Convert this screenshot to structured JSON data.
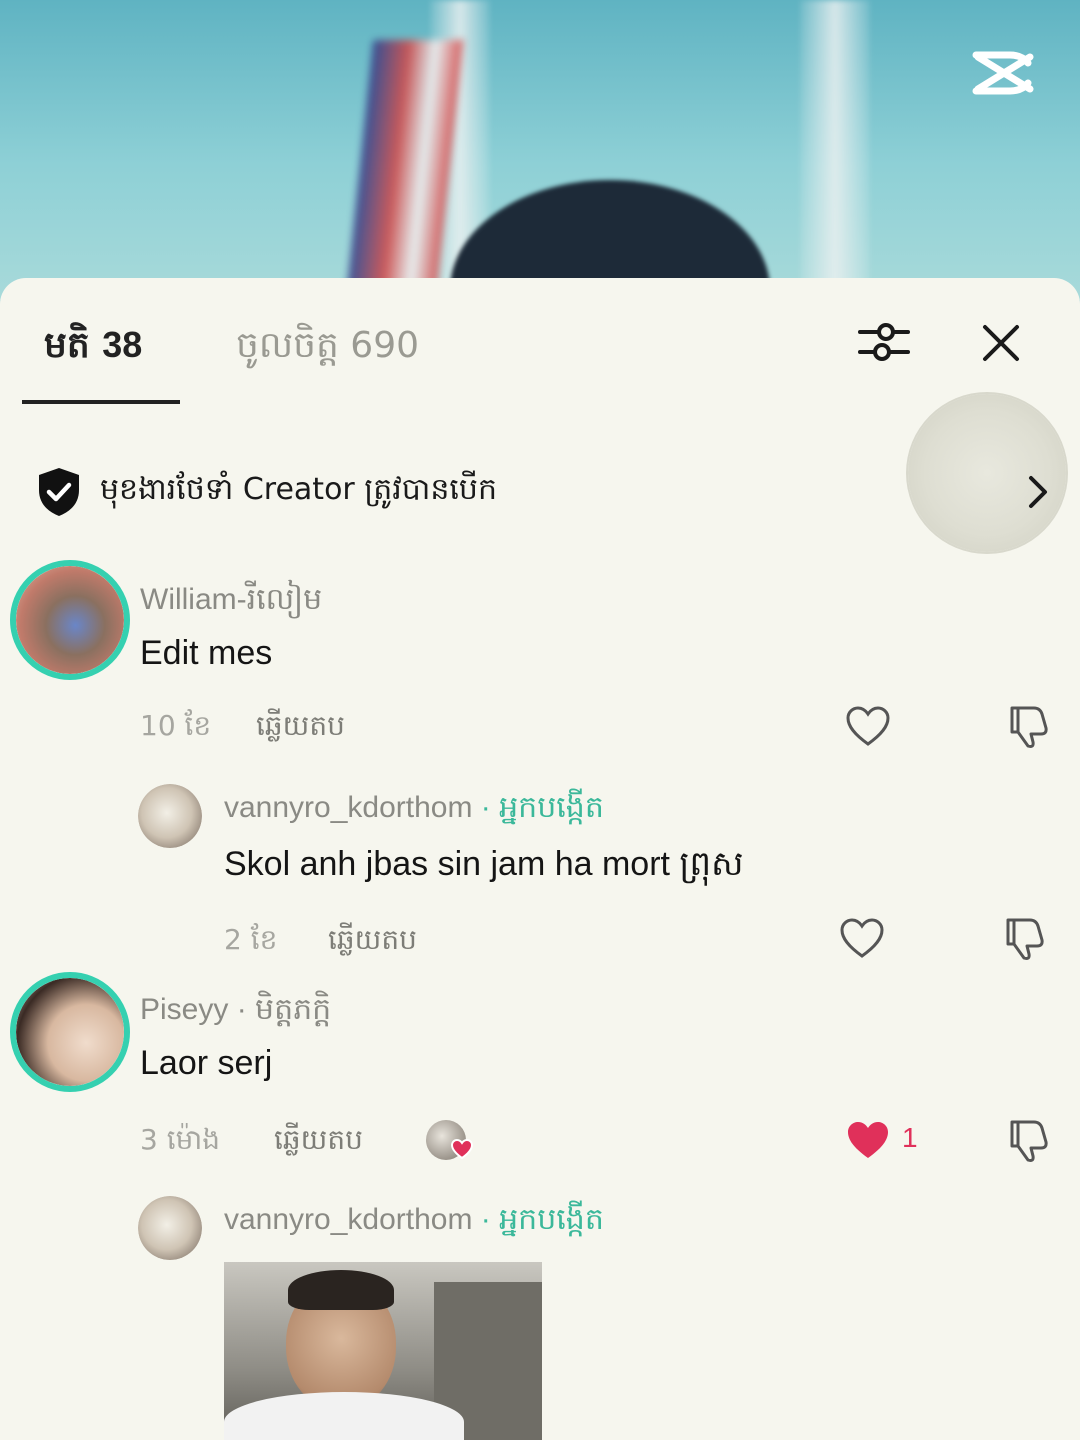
{
  "tabs": {
    "likes": {
      "label": "មតិ",
      "count": "38"
    },
    "favorites": {
      "label": "ចូលចិត្ត",
      "count": "690"
    }
  },
  "creator_notice": "មុខងារថែទាំ Creator ត្រូវបានបើក",
  "comments": [
    {
      "username": "William-រីលៀម",
      "role": "",
      "text": "Edit mes",
      "time": "10 ខែ",
      "reply_label": "ឆ្លើយតប",
      "liked": false,
      "like_count": ""
    },
    {
      "username": "vannyro_kdorthom",
      "role": " · អ្នកបង្កើត",
      "text": "Skol anh jbas sin jam ha mort ព្រុស",
      "time": "2 ខែ",
      "reply_label": "ឆ្លើយតប",
      "liked": false,
      "like_count": ""
    },
    {
      "username": "Piseyy",
      "role": " · មិត្តភក្តិ",
      "text": "Laor serj",
      "time": "3 ម៉ោង",
      "reply_label": "ឆ្លើយតប",
      "liked": true,
      "like_count": "1"
    },
    {
      "username": "vannyro_kdorthom",
      "role": " · អ្នកបង្កើត",
      "text": "",
      "time": "",
      "reply_label": "",
      "liked": false,
      "like_count": ""
    }
  ],
  "colors": {
    "accent_teal": "#35d0b0",
    "creator_green": "#3bb89a",
    "like_red": "#e0305a"
  },
  "icons": [
    "capcut-logo",
    "filter-icon",
    "close-icon",
    "shield-check-icon",
    "chevron-right-icon",
    "heart-icon",
    "dislike-icon"
  ]
}
